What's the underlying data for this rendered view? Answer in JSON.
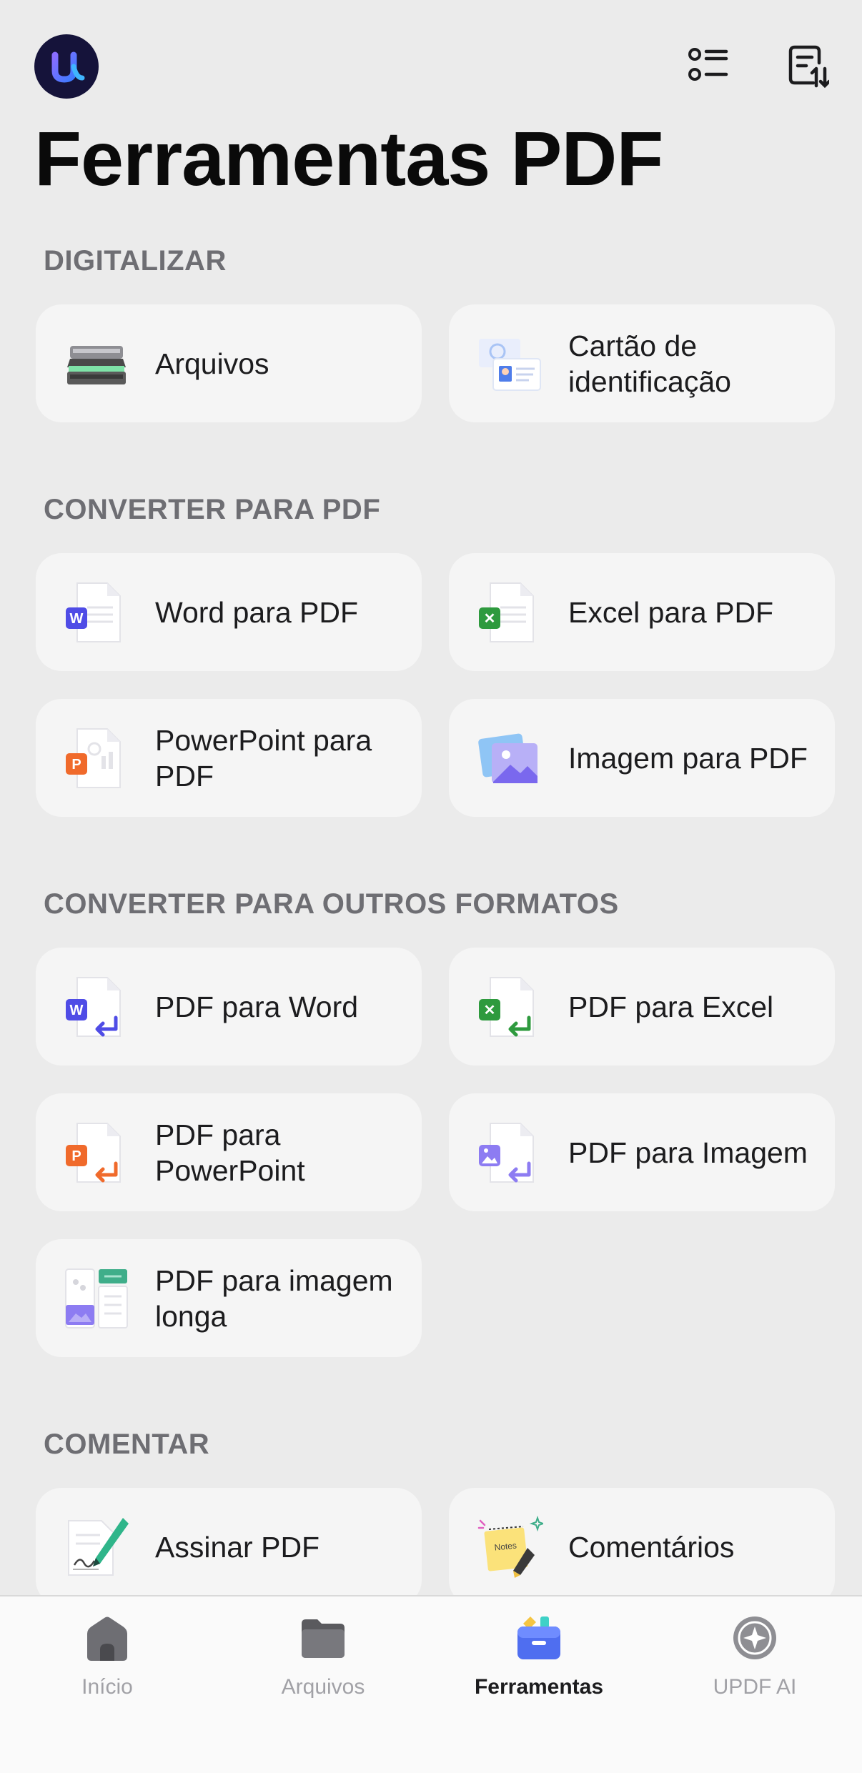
{
  "header": {
    "title": "Ferramentas PDF",
    "logo_icon": "updf-logo-icon",
    "list_icon": "list-icon",
    "sort_icon": "sort-document-icon"
  },
  "sections": {
    "scan": {
      "title": "DIGITALIZAR",
      "items": [
        {
          "label": "Arquivos",
          "icon": "scanner-icon"
        },
        {
          "label": "Cartão de identificação",
          "icon": "id-card-icon"
        }
      ]
    },
    "to_pdf": {
      "title": "CONVERTER PARA PDF",
      "items": [
        {
          "label": "Word para PDF",
          "icon": "word-doc-icon"
        },
        {
          "label": "Excel para PDF",
          "icon": "excel-doc-icon"
        },
        {
          "label": "PowerPoint para PDF",
          "icon": "powerpoint-doc-icon"
        },
        {
          "label": "Imagem para PDF",
          "icon": "image-stack-icon"
        }
      ]
    },
    "to_other": {
      "title": "CONVERTER PARA OUTROS FORMATOS",
      "items": [
        {
          "label": "PDF para Word",
          "icon": "pdf-to-word-icon"
        },
        {
          "label": "PDF para Excel",
          "icon": "pdf-to-excel-icon"
        },
        {
          "label": "PDF para PowerPoint",
          "icon": "pdf-to-powerpoint-icon"
        },
        {
          "label": "PDF para Imagem",
          "icon": "pdf-to-image-icon"
        },
        {
          "label": "PDF para imagem longa",
          "icon": "pdf-to-long-image-icon"
        }
      ]
    },
    "comment": {
      "title": "COMENTAR",
      "items": [
        {
          "label": "Assinar PDF",
          "icon": "signature-pen-icon"
        },
        {
          "label": "Comentários",
          "icon": "sticky-notes-icon"
        }
      ]
    }
  },
  "tab_bar": {
    "tabs": [
      {
        "label": "Início",
        "icon": "home-icon",
        "active": false
      },
      {
        "label": "Arquivos",
        "icon": "folder-icon",
        "active": false
      },
      {
        "label": "Ferramentas",
        "icon": "toolbox-icon",
        "active": true
      },
      {
        "label": "UPDF AI",
        "icon": "ai-icon",
        "active": false
      }
    ]
  },
  "colors": {
    "background": "#ebebeb",
    "card": "#f5f5f5",
    "section_title": "#6e6e73",
    "word": "#4f4ce6",
    "excel": "#2e9a3e",
    "powerpoint": "#f06a2b",
    "image": "#8d7cf2"
  }
}
